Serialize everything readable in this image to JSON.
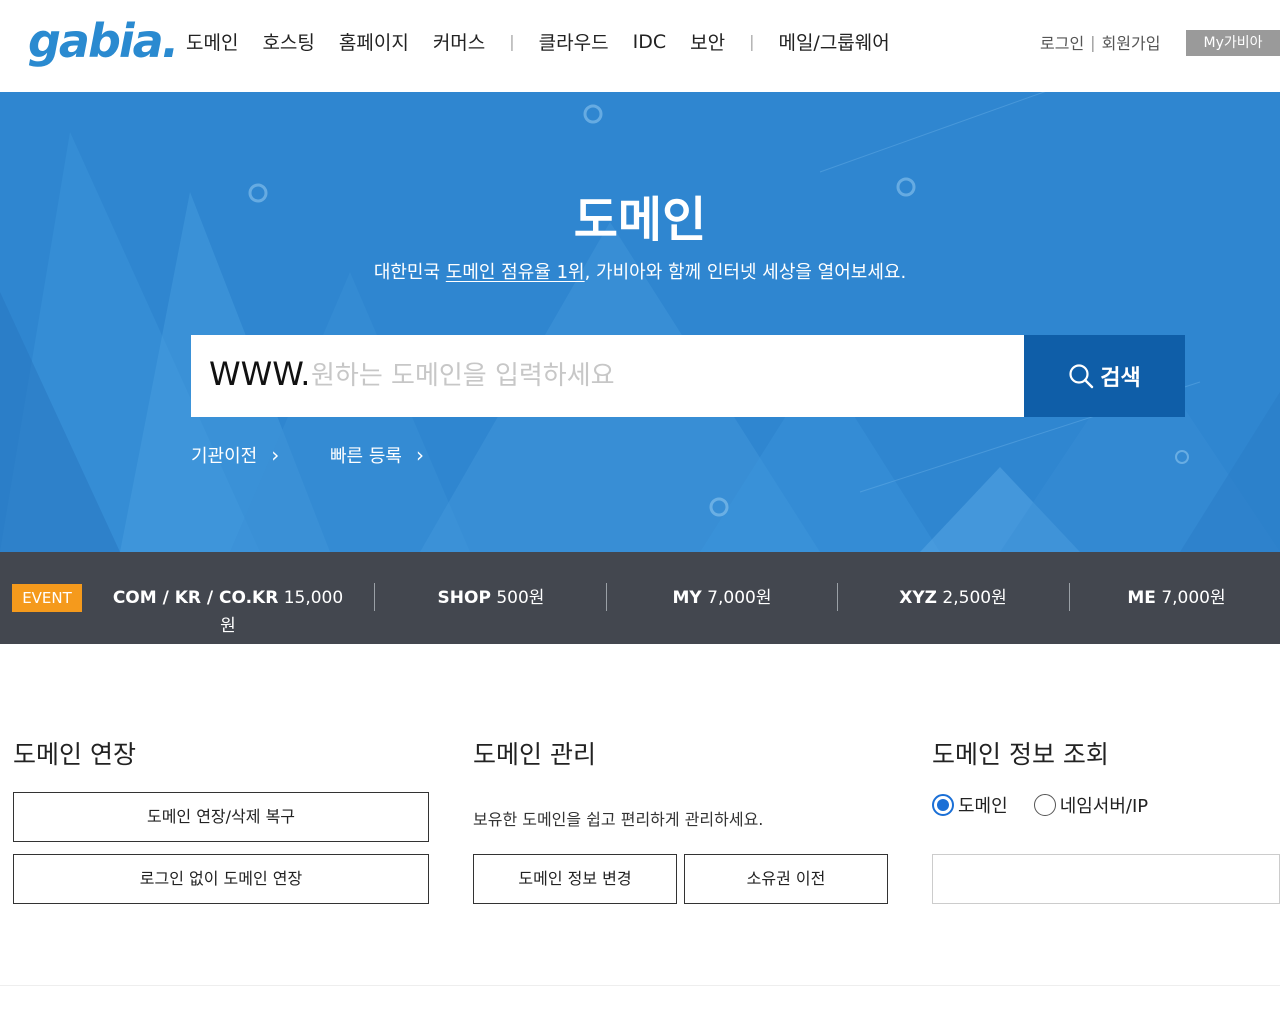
{
  "header": {
    "logo": "gabia.",
    "nav": [
      "도메인",
      "호스팅",
      "홈페이지",
      "커머스",
      "클라우드",
      "IDC",
      "보안",
      "메일/그룹웨어"
    ],
    "login": "로그인",
    "signup": "회원가입",
    "my_button": "My가비아"
  },
  "hero": {
    "title": "도메인",
    "subtitle_pre": "대한민국 ",
    "subtitle_link": "도메인 점유율 1위",
    "subtitle_post": ", 가비아와 함께 인터넷 세상을 열어보세요.",
    "www_prefix": "WWW.",
    "search_placeholder": "원하는 도메인을 입력하세요",
    "search_value": "",
    "search_button": "검색",
    "quick_links": [
      "기관이전",
      "빠른 등록"
    ]
  },
  "event_bar": {
    "badge": "EVENT",
    "items": [
      {
        "name": "COM / KR / CO.KR",
        "price": "15,000원"
      },
      {
        "name": "SHOP",
        "price": "500원"
      },
      {
        "name": "MY",
        "price": "7,000원"
      },
      {
        "name": "XYZ",
        "price": "2,500원"
      },
      {
        "name": "ME",
        "price": "7,000원"
      }
    ]
  },
  "sections": {
    "renew": {
      "title": "도메인 연장",
      "buttons": [
        "도메인 연장/삭제 복구",
        "로그인 없이 도메인 연장"
      ]
    },
    "manage": {
      "title": "도메인 관리",
      "description": "보유한 도메인을 쉽고 편리하게 관리하세요.",
      "buttons": [
        "도메인 정보 변경",
        "소유권 이전"
      ]
    },
    "lookup": {
      "title": "도메인 정보 조회",
      "radio_options": [
        "도메인",
        "네임서버/IP"
      ],
      "selected": "도메인",
      "input_value": ""
    }
  },
  "colors": {
    "hero_blue": "#2f86d0",
    "search_button_blue": "#0f5ea8",
    "event_bar_bg": "#43474f",
    "event_badge": "#f59a1c"
  }
}
